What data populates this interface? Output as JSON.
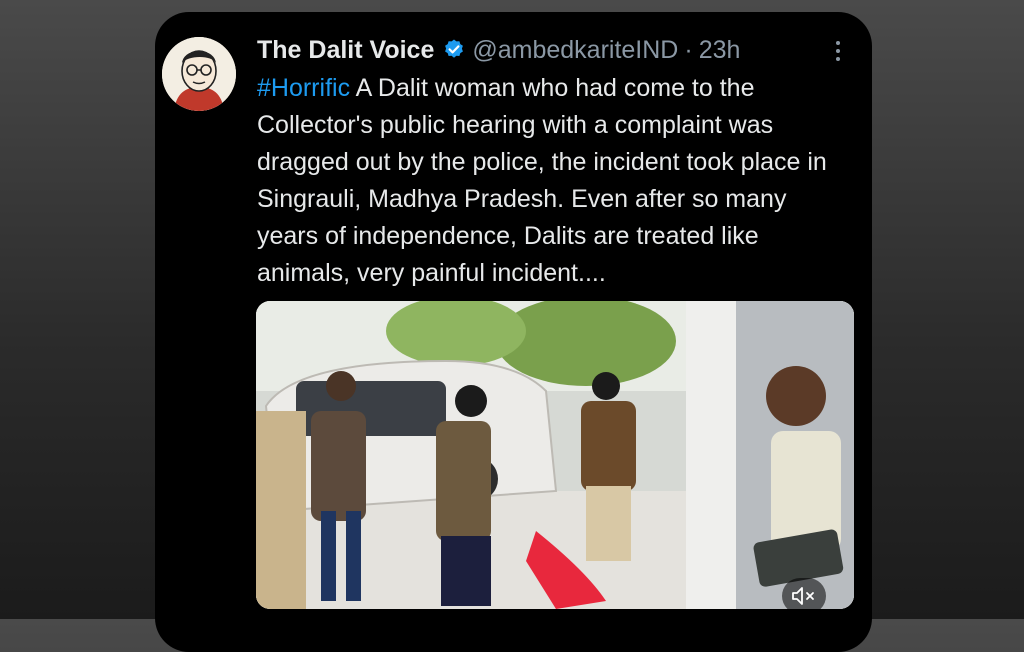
{
  "tweet": {
    "display_name": "The Dalit Voice",
    "handle": "@ambedkariteIND",
    "separator": "·",
    "time": "23h",
    "hashtag": "#Horrific",
    "body": " A Dalit woman who had come to the Collector's public hearing with a complaint was dragged out by the police, the incident took place in Singrauli, Madhya Pradesh. Even after so many years of independence, Dalits are treated like animals, very painful incident...."
  },
  "icons": {
    "verified": "verified-badge-icon",
    "more": "more-options-icon",
    "mute": "muted-speaker-icon"
  },
  "colors": {
    "link": "#1d9bf0",
    "text": "#e7e9ea",
    "secondary": "#8b98a5",
    "card_bg": "#000000"
  }
}
